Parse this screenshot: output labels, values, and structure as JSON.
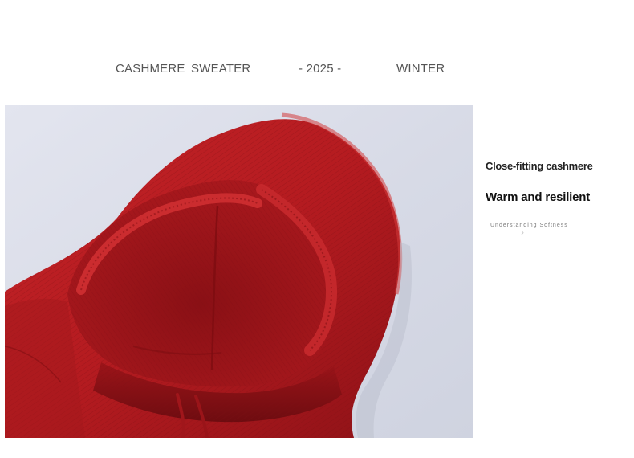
{
  "header": {
    "word_1": "CASHMERE",
    "word_2": "SWEATER",
    "year": "-  2025 -",
    "season": "WINTER"
  },
  "product_image": {
    "subject": "red knitted cashmere hoodie",
    "background_color": "#dcdfea",
    "primary_color": "#b51b20"
  },
  "side_copy": {
    "line_1": "Close-fitting cashmere",
    "line_2": "Warm and resilient",
    "line_3": "Understanding Softness"
  }
}
